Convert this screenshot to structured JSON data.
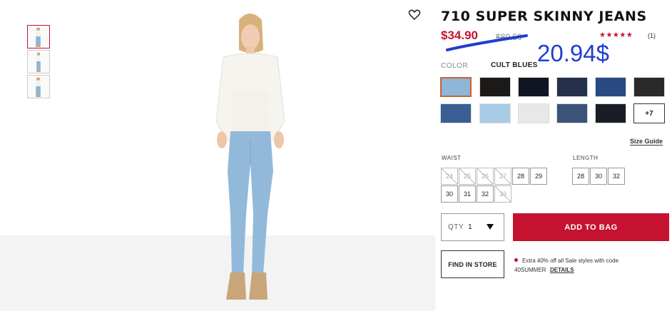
{
  "product": {
    "title": "710 SUPER SKINNY JEANS",
    "price": "$34.90",
    "old_price": "$89.50",
    "rating_stars": "★★★★★",
    "rating_count": "(1)"
  },
  "annotation": {
    "text": "20.94$",
    "color": "#1f3fcf"
  },
  "color": {
    "label": "COLOR",
    "selected_name": "CULT BLUES",
    "swatches": [
      "#8fb5d8",
      "#1c1a18",
      "#101522",
      "#26304a",
      "#2a4a82",
      "#2a2a2a",
      "#3a5d94",
      "#a8cbe6",
      "#e8e8e6",
      "#3b5378",
      "#1b1d26"
    ],
    "more_label": "+7"
  },
  "size_guide_label": "Size Guide",
  "waist": {
    "label": "WAIST",
    "sizes": [
      {
        "v": "24",
        "available": false
      },
      {
        "v": "25",
        "available": false
      },
      {
        "v": "26",
        "available": false
      },
      {
        "v": "27",
        "available": false
      },
      {
        "v": "28",
        "available": true
      },
      {
        "v": "29",
        "available": true
      },
      {
        "v": "30",
        "available": true
      },
      {
        "v": "31",
        "available": true
      },
      {
        "v": "32",
        "available": true
      },
      {
        "v": "33",
        "available": false
      }
    ]
  },
  "length": {
    "label": "LENGTH",
    "sizes": [
      "28",
      "30",
      "32"
    ]
  },
  "qty": {
    "label": "QTY",
    "value": "1"
  },
  "add_to_bag_label": "ADD TO BAG",
  "find_in_store_label": "FIND IN STORE",
  "promo": {
    "text": "Extra 40% off all Sale styles with code",
    "code": "40SUMMER",
    "details_label": "DETAILS"
  },
  "colors": {
    "brand_red": "#c41230",
    "selected_border": "#c8642d"
  }
}
